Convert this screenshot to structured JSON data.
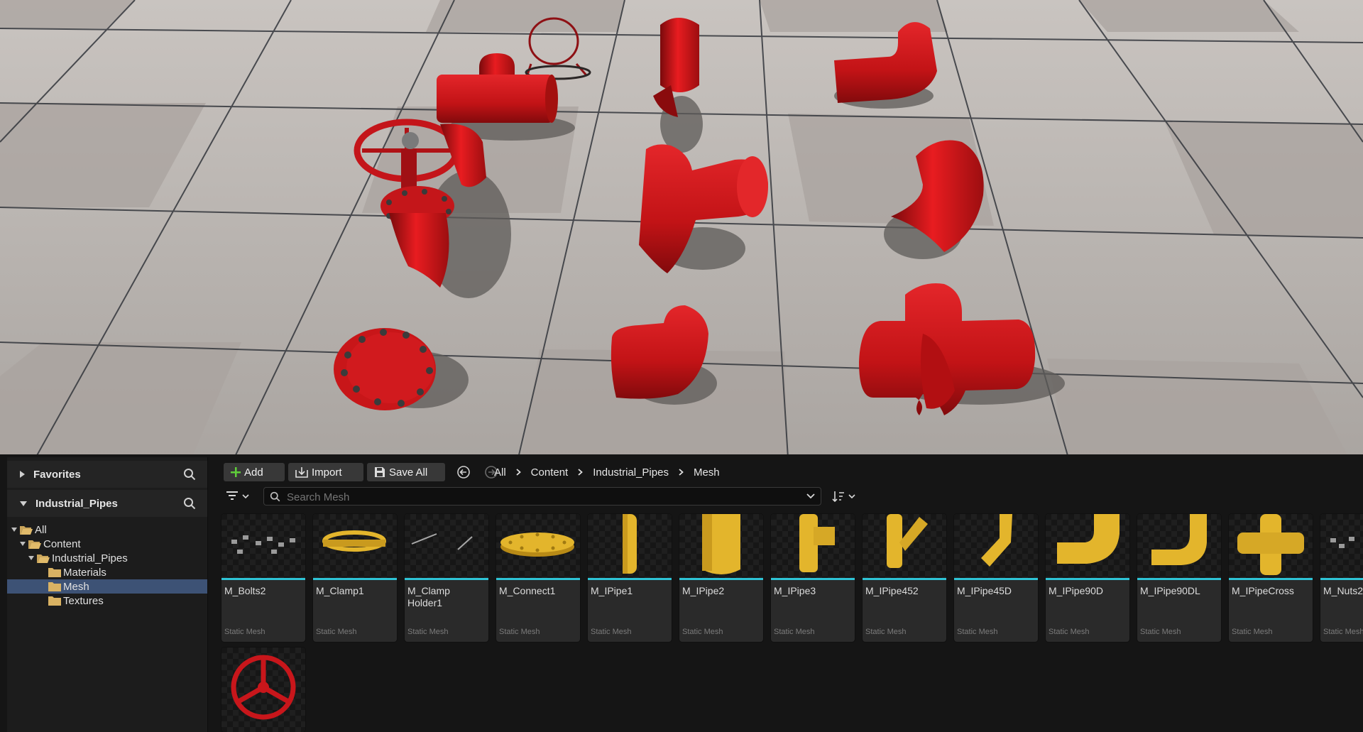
{
  "left_panel": {
    "favorites_label": "Favorites",
    "collection_label": "Industrial_Pipes",
    "tree": {
      "all": "All",
      "content": "Content",
      "industrial_pipes": "Industrial_Pipes",
      "materials": "Materials",
      "mesh": "Mesh",
      "textures": "Textures"
    }
  },
  "toolbar": {
    "add_label": "Add",
    "import_label": "Import",
    "save_all_label": "Save All"
  },
  "breadcrumb": [
    "All",
    "Content",
    "Industrial_Pipes",
    "Mesh"
  ],
  "search": {
    "placeholder": "Search Mesh"
  },
  "assets": [
    {
      "name": "M_Bolts2",
      "type": "Static Mesh"
    },
    {
      "name": "M_Clamp1",
      "type": "Static Mesh"
    },
    {
      "name": "M_Clamp Holder1",
      "type": "Static Mesh"
    },
    {
      "name": "M_Connect1",
      "type": "Static Mesh"
    },
    {
      "name": "M_IPipe1",
      "type": "Static Mesh"
    },
    {
      "name": "M_IPipe2",
      "type": "Static Mesh"
    },
    {
      "name": "M_IPipe3",
      "type": "Static Mesh"
    },
    {
      "name": "M_IPipe452",
      "type": "Static Mesh"
    },
    {
      "name": "M_IPipe45D",
      "type": "Static Mesh"
    },
    {
      "name": "M_IPipe90D",
      "type": "Static Mesh"
    },
    {
      "name": "M_IPipe90DL",
      "type": "Static Mesh"
    },
    {
      "name": "M_IPipeCross",
      "type": "Static Mesh"
    },
    {
      "name": "M_Nuts2",
      "type": "Static Mesh"
    }
  ],
  "colors": {
    "accent": "#2ec4d6",
    "mesh_yellow": "#e3b52c",
    "pipe_red": "#d8171b",
    "selection": "#3d5275"
  }
}
